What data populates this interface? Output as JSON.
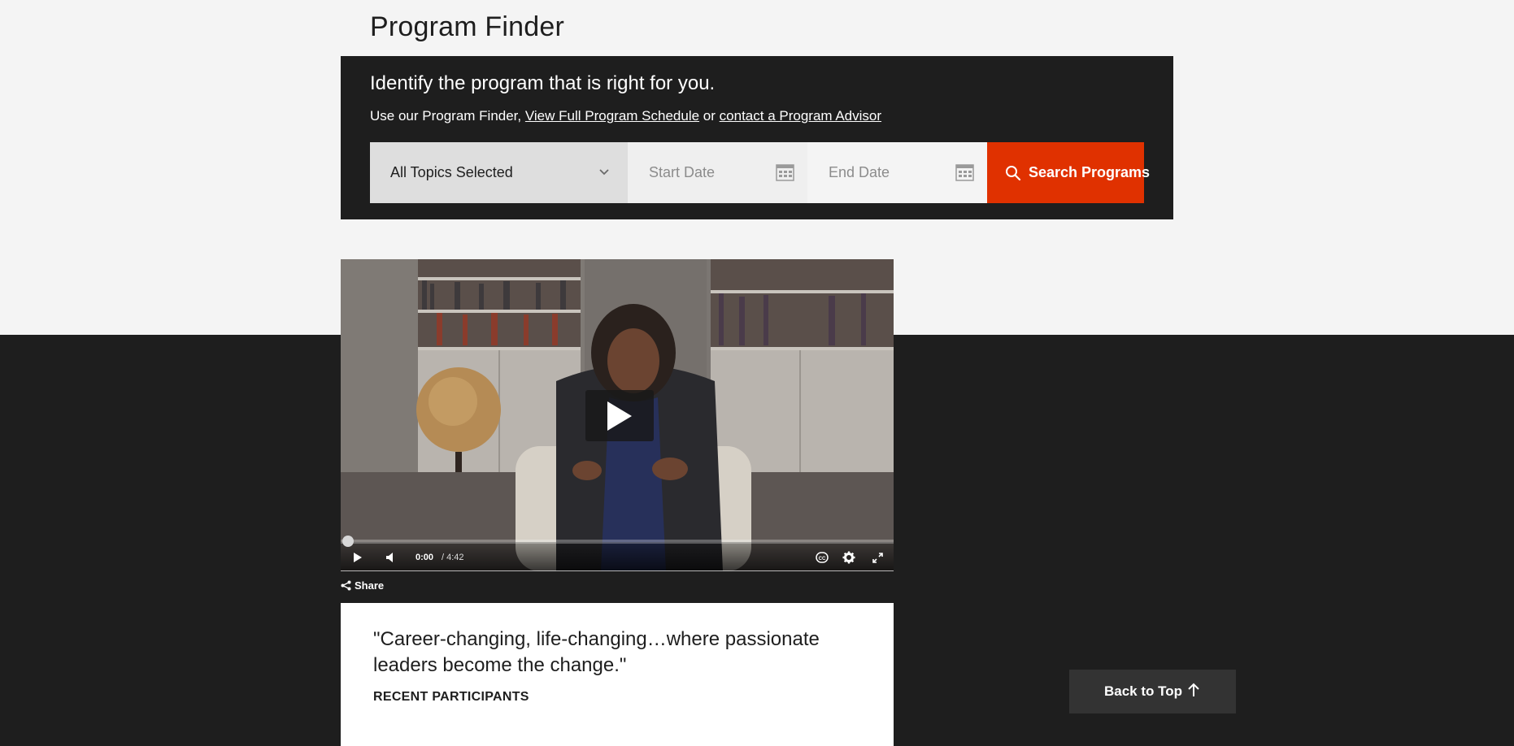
{
  "page": {
    "title": "Program Finder"
  },
  "finder": {
    "heading": "Identify the program that is right for you.",
    "sub_prefix": "Use our Program Finder,",
    "schedule_link": "View Full Program Schedule",
    "sub_or": "or",
    "advisor_link": "contact a Program Advisor",
    "topic_select": {
      "value": "All Topics Selected",
      "icon": "chevron-down-icon"
    },
    "start_date": {
      "placeholder": "Start Date",
      "icon": "calendar-icon"
    },
    "end_date": {
      "placeholder": "End Date",
      "icon": "calendar-icon"
    },
    "search_button": {
      "label": "Search Programs",
      "icon": "search-icon"
    }
  },
  "video": {
    "current_time": "0:00",
    "duration": "/ 4:42",
    "progress": 0,
    "controls": [
      "play-icon",
      "volume-icon",
      "closed-captions-icon",
      "settings-gear-icon",
      "fullscreen-icon"
    ],
    "share_label": "Share"
  },
  "testimonial": {
    "quote": "\"Career-changing, life-changing…where passionate leaders become the change.\"",
    "attribution": "RECENT PARTICIPANTS"
  },
  "back_to_top": {
    "label": "Back to Top",
    "icon": "arrow-up-icon"
  },
  "colors": {
    "accent": "#e03100",
    "dark": "#1e1e1e",
    "light_bg": "#f4f4f4"
  }
}
